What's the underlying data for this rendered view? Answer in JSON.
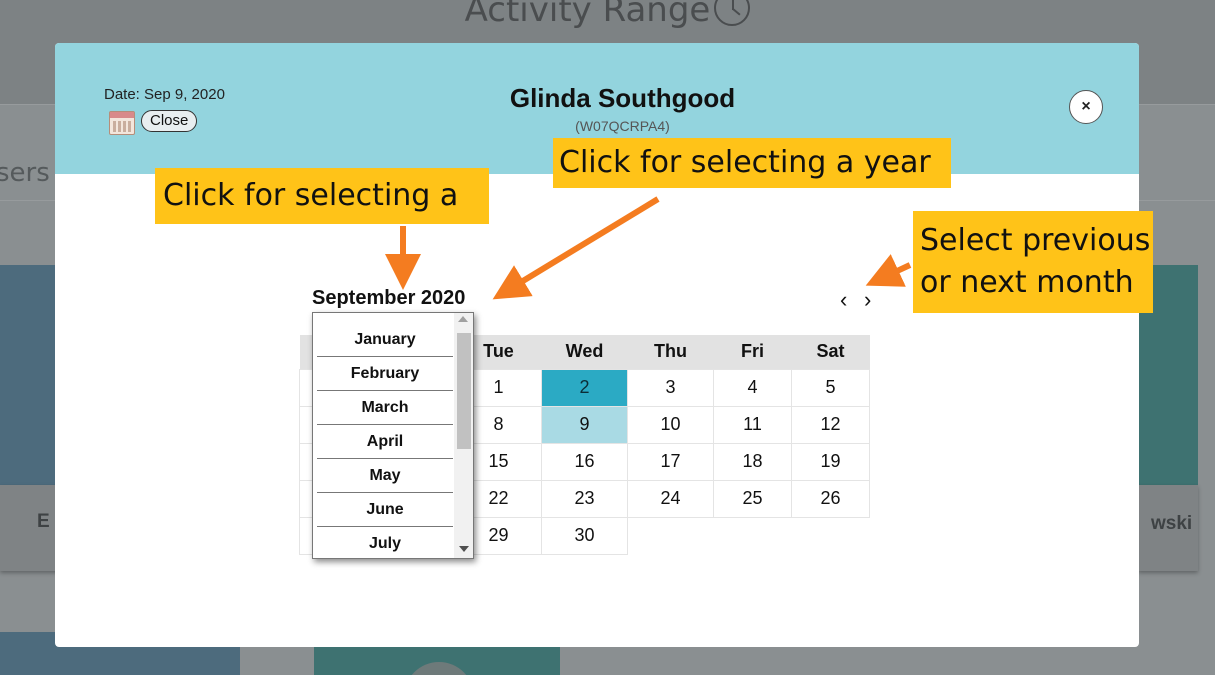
{
  "background": {
    "page_title": "Activity Range",
    "users_fragment": "sers",
    "left_card_fragment": "E",
    "right_card_fragment": "wski"
  },
  "modal": {
    "date_label": "Date: Sep 9, 2020",
    "close_label": "Close",
    "user_name": "Glinda Southgood",
    "user_id": "(W07QCRPA4)",
    "dismiss_label": "×"
  },
  "calendar": {
    "month_year": "September 2020",
    "prev_label": "‹",
    "next_label": "›",
    "weekdays": [
      "Tue",
      "Wed",
      "Thu",
      "Fri",
      "Sat"
    ],
    "weeks": [
      [
        "1",
        "2",
        "3",
        "4",
        "5"
      ],
      [
        "8",
        "9",
        "10",
        "11",
        "12"
      ],
      [
        "15",
        "16",
        "17",
        "18",
        "19"
      ],
      [
        "22",
        "23",
        "24",
        "25",
        "26"
      ],
      [
        "29",
        "30",
        "",
        "",
        ""
      ]
    ],
    "today": "2",
    "selected": "9",
    "today_color": "#2baac4",
    "selected_color": "#a9dae4"
  },
  "month_dropdown": {
    "options": [
      "January",
      "February",
      "March",
      "April",
      "May",
      "June",
      "July"
    ]
  },
  "annotations": {
    "month_hint": "Click for selecting a",
    "year_hint": "Click for selecting a year",
    "nav_hint_line1": "Select previous",
    "nav_hint_line2": "or next month",
    "callout_color": "#ffc318",
    "arrow_color": "#f47c20"
  }
}
